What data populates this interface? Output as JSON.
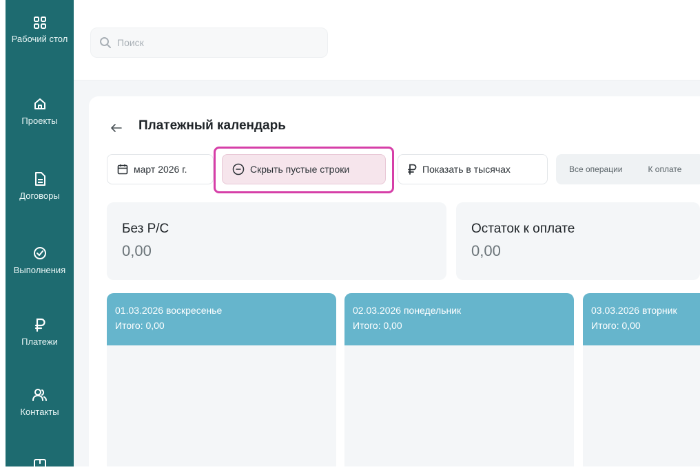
{
  "sidebar": {
    "items": [
      {
        "label": "Рабочий стол",
        "icon": "dashboard-grid-icon"
      },
      {
        "label": "Проекты",
        "icon": "home-icon"
      },
      {
        "label": "Договоры",
        "icon": "document-icon"
      },
      {
        "label": "Выполнения",
        "icon": "check-circle-icon"
      },
      {
        "label": "Платежи",
        "icon": "ruble-icon"
      },
      {
        "label": "Контакты",
        "icon": "users-icon"
      }
    ]
  },
  "search": {
    "placeholder": "Поиск",
    "icon": "search-icon"
  },
  "page": {
    "title": "Платежный календарь",
    "back_icon": "arrow-left-icon"
  },
  "toolbar": {
    "period": "март 2026 г.",
    "hide_empty": "Скрыть пустые строки",
    "show_thousands": "Показать в тысячах",
    "filters": [
      "Все операции",
      "К оплате"
    ]
  },
  "summary": [
    {
      "label": "Без Р/С",
      "value": "0,00"
    },
    {
      "label": "Остаток к оплате",
      "value": "0,00"
    }
  ],
  "days": [
    {
      "date": "01.03.2026 воскресенье",
      "total": "Итого: 0,00"
    },
    {
      "date": "02.03.2026 понедельник",
      "total": "Итого: 0,00"
    },
    {
      "date": "03.03.2026 вторник",
      "total": "Итого: 0,00"
    }
  ],
  "colors": {
    "sidebar": "#1e6b70",
    "day_header": "#66b5cc",
    "highlight": "#d63fa8"
  }
}
